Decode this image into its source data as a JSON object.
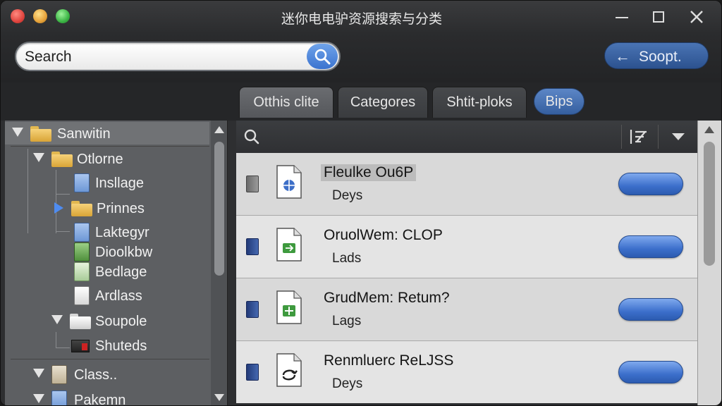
{
  "window": {
    "title": "迷你电电驴资源搜索与分类"
  },
  "toolbar": {
    "search_placeholder": "Search",
    "back_label": "Soopt.",
    "back_arrow": "←"
  },
  "tabs": [
    {
      "label": "Otthis clite",
      "active": true
    },
    {
      "label": "Categores",
      "active": false
    },
    {
      "label": "Shtit-ploks",
      "active": false
    },
    {
      "label": "Bips",
      "active": false
    }
  ],
  "sidebar": {
    "items": [
      {
        "label": "Sanwitin",
        "icon": "folder-icon",
        "expanded": true
      },
      {
        "label": "Otlorne",
        "icon": "folder-icon",
        "expanded": true
      },
      {
        "label": "Insllage",
        "icon": "document-icon"
      },
      {
        "label": "Prinnes",
        "icon": "folder-icon",
        "expanded": false
      },
      {
        "label": "Laktegyr",
        "icon": "document-icon"
      },
      {
        "label": "Dioolkbw",
        "icon": "document-icon"
      },
      {
        "label": "Bedlage",
        "icon": "document-icon"
      },
      {
        "label": "Ardlass",
        "icon": "document-icon"
      },
      {
        "label": "Soupole",
        "icon": "folder-icon",
        "expanded": true
      },
      {
        "label": "Shuteds",
        "icon": "media-icon"
      },
      {
        "label": "Class..",
        "icon": "stack-icon",
        "expanded": true
      },
      {
        "label": "Pakemn",
        "icon": "document-icon",
        "expanded": true
      }
    ]
  },
  "results": [
    {
      "name": "Fleulke Ou6P",
      "sub": "Deys",
      "icon": "globe-file-icon"
    },
    {
      "name": "OruolWem: CLOP",
      "sub": "Lads",
      "icon": "add-file-icon"
    },
    {
      "name": "GrudMem: Retum?",
      "sub": "Lags",
      "icon": "plus-file-icon"
    },
    {
      "name": "Renmluerc ReLJSS",
      "sub": "Deys",
      "icon": "refresh-file-icon"
    }
  ],
  "colors": {
    "accent": "#3b73cf",
    "sidebar_bg": "#5d5f62",
    "folder": "#e7b84a"
  }
}
